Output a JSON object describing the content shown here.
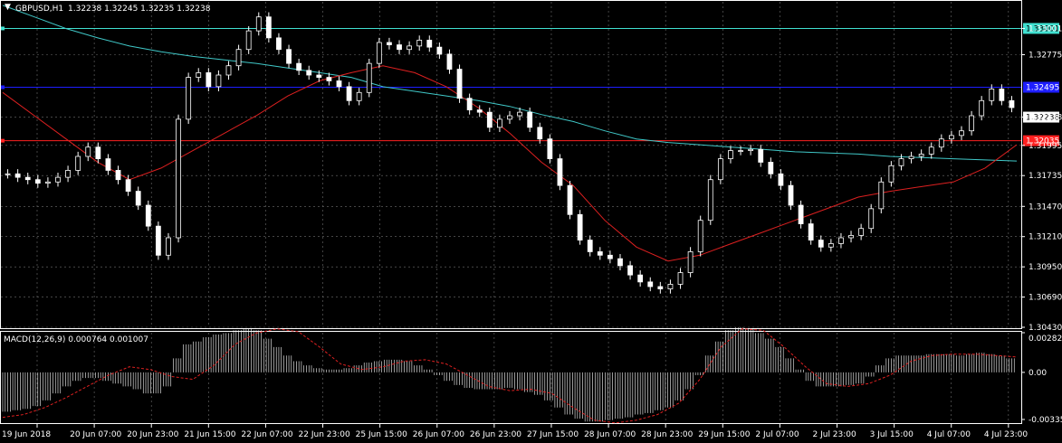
{
  "chart_data": [
    {
      "type": "candlestick",
      "title": "GBPUSD,H1",
      "ohlc_text": "1.32238 1.32245 1.32235 1.32238",
      "ylim": [
        1.3043,
        1.3323
      ],
      "y_ticks": [
        "1.33001",
        "1.32775",
        "1.32238",
        "1.31995",
        "1.31735",
        "1.31470",
        "1.31210",
        "1.30950",
        "1.30690",
        "1.30430"
      ],
      "x_ticks": [
        "19 Jun 2018",
        "20 Jun 07:00",
        "20 Jun 23:00",
        "21 Jun 15:00",
        "22 Jun 07:00",
        "22 Jun 23:00",
        "25 Jun 15:00",
        "26 Jun 07:00",
        "26 Jun 23:00",
        "27 Jun 15:00",
        "28 Jun 07:00",
        "28 Jun 23:00",
        "29 Jun 15:00",
        "2 Jul 07:00",
        "2 Jul 23:00",
        "3 Jul 15:00",
        "4 Jul 07:00",
        "4 Jul 23:00"
      ],
      "horizontal_lines": [
        {
          "price": 1.33001,
          "label": "1.33001",
          "color": "#40E0D0"
        },
        {
          "price": 1.32495,
          "label": "1.32495",
          "color": "#1E1EFF"
        },
        {
          "price": 1.32035,
          "label": "1.32035",
          "color": "#FF2020"
        }
      ],
      "current_price": "1.32238",
      "series": [
        {
          "name": "close",
          "color": "#FFFFFF",
          "values": [
            1.3175,
            1.3172,
            1.317,
            1.3167,
            1.3168,
            1.3172,
            1.3178,
            1.319,
            1.3198,
            1.3188,
            1.3178,
            1.317,
            1.316,
            1.3148,
            1.313,
            1.3105,
            1.312,
            1.3222,
            1.3258,
            1.3262,
            1.325,
            1.326,
            1.3268,
            1.3282,
            1.3298,
            1.331,
            1.3292,
            1.3282,
            1.327,
            1.3264,
            1.326,
            1.3258,
            1.3255,
            1.325,
            1.3238,
            1.3245,
            1.327,
            1.3288,
            1.3286,
            1.3282,
            1.3285,
            1.329,
            1.3284,
            1.3278,
            1.3265,
            1.324,
            1.323,
            1.3228,
            1.3215,
            1.3222,
            1.3225,
            1.3228,
            1.3215,
            1.3205,
            1.3188,
            1.3165,
            1.314,
            1.3118,
            1.3108,
            1.3105,
            1.3102,
            1.3096,
            1.3088,
            1.3082,
            1.3078,
            1.3076,
            1.308,
            1.309,
            1.3108,
            1.3135,
            1.317,
            1.3188,
            1.3195,
            1.3195,
            1.3196,
            1.3185,
            1.3175,
            1.3165,
            1.3148,
            1.3132,
            1.3118,
            1.3112,
            1.3115,
            1.312,
            1.3122,
            1.3128,
            1.3145,
            1.3168,
            1.3182,
            1.3188,
            1.319,
            1.3192,
            1.3198,
            1.3205,
            1.3208,
            1.3212,
            1.3225,
            1.3238,
            1.3248,
            1.3238,
            1.3232
          ]
        },
        {
          "name": "slow-ma",
          "color": "#40C8C8",
          "values": [
            1.332,
            1.331,
            1.33,
            1.3292,
            1.3285,
            1.328,
            1.3276,
            1.3273,
            1.327,
            1.3266,
            1.3262,
            1.3258,
            1.325,
            1.3246,
            1.3242,
            1.3238,
            1.3233,
            1.3226,
            1.322,
            1.3212,
            1.3205,
            1.3202,
            1.32,
            1.3198,
            1.3196,
            1.3194,
            1.3193,
            1.3192,
            1.319,
            1.3189,
            1.3188,
            1.3187,
            1.3186
          ]
        },
        {
          "name": "fast-ma",
          "color": "#DD2020",
          "values": [
            1.3245,
            1.3225,
            1.3205,
            1.3185,
            1.317,
            1.318,
            1.3195,
            1.321,
            1.3225,
            1.3242,
            1.3255,
            1.3262,
            1.3268,
            1.3262,
            1.325,
            1.3232,
            1.321,
            1.3185,
            1.3165,
            1.3135,
            1.3112,
            1.31,
            1.3105,
            1.3115,
            1.3125,
            1.3135,
            1.3145,
            1.3155,
            1.316,
            1.3164,
            1.3168,
            1.318,
            1.32
          ]
        }
      ]
    },
    {
      "type": "bar",
      "title": "MACD(12,26,9) 0.000764 0.001007",
      "ylim": [
        -0.00355,
        0.002826
      ],
      "y_ticks": [
        "0.002826",
        "0.00",
        "-0.003355"
      ],
      "series": [
        {
          "name": "macd",
          "color": "#FFFFFF",
          "values": [
            -0.0028,
            -0.0027,
            -0.0026,
            -0.0024,
            -0.002,
            -0.0015,
            -0.001,
            -0.0006,
            -0.0004,
            -0.0004,
            -0.0006,
            -0.0008,
            -0.001,
            -0.0012,
            -0.0015,
            -0.0015,
            -0.001,
            0.001,
            0.002,
            0.0022,
            0.0025,
            0.0027,
            0.0028,
            0.003,
            0.0031,
            0.003,
            0.0024,
            0.0018,
            0.0012,
            0.0008,
            0.0005,
            0.0003,
            0.0002,
            0.0002,
            0.0003,
            0.0005,
            0.0007,
            0.0008,
            0.0009,
            0.0009,
            0.0008,
            0.0005,
            0.0002,
            -0.0002,
            -0.0006,
            -0.0009,
            -0.0011,
            -0.0012,
            -0.0012,
            -0.0012,
            -0.0011,
            -0.0012,
            -0.0014,
            -0.0016,
            -0.002,
            -0.0025,
            -0.003,
            -0.0033,
            -0.0035,
            -0.0035,
            -0.0034,
            -0.0033,
            -0.0032,
            -0.003,
            -0.0029,
            -0.0027,
            -0.0025,
            -0.002,
            -0.0012,
            -0.0002,
            0.0012,
            0.0022,
            0.003,
            0.0032,
            0.0031,
            0.0028,
            0.0024,
            0.0018,
            0.001,
            0.0002,
            -0.0006,
            -0.001,
            -0.001,
            -0.001,
            -0.0009,
            -0.0008,
            -0.0003,
            0.0005,
            0.001,
            0.0012,
            0.0012,
            0.0012,
            0.0013,
            0.0013,
            0.0013,
            0.0012,
            0.0013,
            0.0014,
            0.0013,
            0.0012,
            0.001
          ]
        },
        {
          "name": "signal",
          "color": "#DD2020",
          "values": [
            -0.0032,
            -0.003,
            -0.0025,
            -0.0018,
            -0.001,
            -0.0002,
            0.0004,
            0.0002,
            -0.0003,
            -0.0005,
            0.0005,
            0.002,
            0.0028,
            0.0031,
            0.0029,
            0.0018,
            0.0006,
            0.0002,
            0.0004,
            0.0008,
            0.0009,
            0.0006,
            -0.0002,
            -0.001,
            -0.0013,
            -0.0012,
            -0.0015,
            -0.0025,
            -0.0034,
            -0.0036,
            -0.0034,
            -0.003,
            -0.0022,
            -0.0005,
            0.0018,
            0.0031,
            0.003,
            0.0018,
            0.0004,
            -0.0008,
            -0.001,
            -0.0008,
            -0.0002,
            0.0008,
            0.0012,
            0.0013,
            0.0013,
            0.0012,
            0.0011
          ]
        }
      ]
    }
  ]
}
